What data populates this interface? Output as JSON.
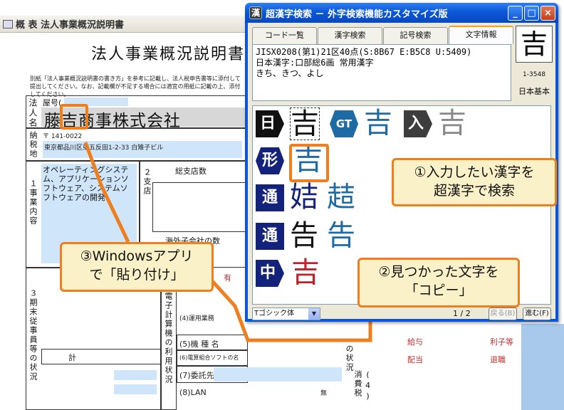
{
  "background_window": {
    "title": "概 表 法人事業概況説明書",
    "form_title": "法人事業概況説明書",
    "note": "別紙「法人事業概況説明書の書き方」を参考に記載し、法人税申告書等に添付して提出してください。なお、記載欄が不足する場合には適宜の用紙に記載の上、添付してください。",
    "label_houjin": "法人名",
    "label_yago": "屋号(",
    "company_name": "藤吉商事株式会社",
    "label_nozeichi": "納税地",
    "postal": "〒 141-0022",
    "address": "東京都品川区東五反田1-2-33 白雉子ビル",
    "label_jigyo": "１事業内容",
    "business": "オペレーティングシステム、アプリケーションソフトウェア、システムソフトウェアの開発",
    "label_shiten": "２支店",
    "label_sou": "総支店数",
    "label_kaigai": "海外子会社の数",
    "label_kimatsu": "３期末従事員等の状況",
    "label_kei": "計",
    "label_denshi": "電子計算機の利用状況",
    "row_kishu": "(5)機 種 名",
    "row_soft": "(6)電算組合ソフトの名",
    "row_itaku": "(7)委託先",
    "row_lan": "(8)LAN",
    "row_unyo": "(4)運用業務",
    "label_jokyo": "の状況",
    "label_shohi": "(4)消費税",
    "label_kyuyo": "給与",
    "label_haito": "配当",
    "label_rishi": "利子等",
    "label_taishoku": "退職",
    "label_mu": "無",
    "label_yu": "有"
  },
  "app": {
    "title": "超漢字検索 － 外字検索機能カスタマイズ版",
    "icon_label": "漢",
    "tabs": [
      "コード一覧",
      "漢字検索",
      "記号検索",
      "文字情報"
    ],
    "active_tab": 3,
    "info_lines": [
      "JISX0208(第1)21区40点(S:8B67 E:B5C8 U:5409)",
      "日本漢字:口部総6画 常用漢字",
      "きち、きつ、よし"
    ],
    "big_kanji": "吉",
    "kanji_code": "1-3548",
    "kanji_base": "日本基本",
    "results": [
      {
        "badge": "日",
        "glyph": "吉"
      },
      {
        "badge": "GT",
        "glyph": "吉"
      },
      {
        "badge": "入",
        "glyph": "吉"
      },
      {
        "badge": "形",
        "glyph": "吉"
      },
      {
        "badge": "通",
        "glyph": "姞"
      },
      {
        "glyph": "趌"
      },
      {
        "badge": "通",
        "glyph": "告"
      },
      {
        "glyph": "告"
      },
      {
        "badge": "中",
        "glyph": "吉"
      }
    ],
    "font_select": "Tゴシック体",
    "page_indicator": "1 / 2",
    "back_button": "戻る(B)",
    "next_button": "進む(F)",
    "colors": {
      "titlebar": "#0a58d8",
      "accent_orange": "#ef7e1e",
      "blue_glyph": "#1d6aa5",
      "red_glyph": "#c0202a",
      "navy_badge": "#13227a"
    }
  },
  "callouts": {
    "step1": "①入力したい漢字を\n超漢字で検索",
    "step2": "②見つかった文字を\n「コピー」",
    "step3": "③Windowsアプリ\nで「貼り付け」"
  }
}
